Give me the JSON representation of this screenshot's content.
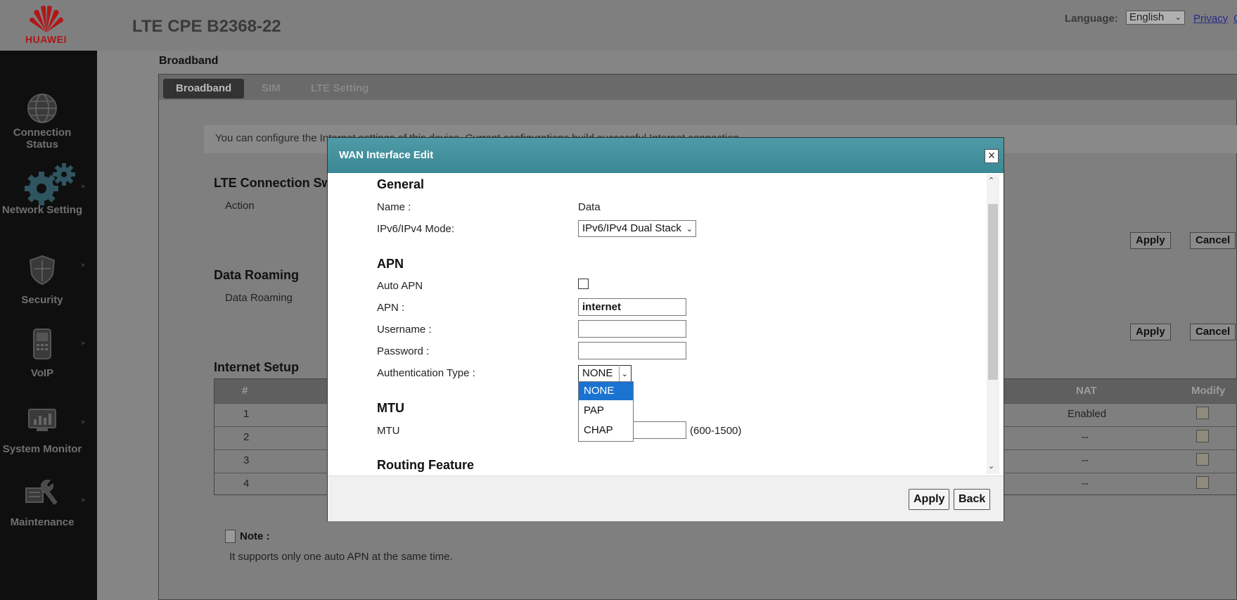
{
  "header": {
    "logo_text": "HUAWEI",
    "product_name": "LTE CPE B2368-22",
    "language_label": "Language:",
    "language_value": "English",
    "privacy_link": "Privacy",
    "privacy_link_cut": "C"
  },
  "sidebar": {
    "items": [
      {
        "label_line1": "Connection",
        "label_line2": "Status",
        "icon": "globe-icon"
      },
      {
        "label_line1": "Network Setting",
        "label_line2": "",
        "icon": "gears-icon"
      },
      {
        "label_line1": "Security",
        "label_line2": "",
        "icon": "shield-icon"
      },
      {
        "label_line1": "VoIP",
        "label_line2": "",
        "icon": "phone-icon"
      },
      {
        "label_line1": "System Monitor",
        "label_line2": "",
        "icon": "monitor-icon"
      },
      {
        "label_line1": "Maintenance",
        "label_line2": "",
        "icon": "wrench-icon"
      }
    ]
  },
  "page": {
    "title": "Broadband",
    "tabs": [
      "Broadband",
      "SIM",
      "LTE Setting"
    ],
    "info_text": "You can configure the Internet settings of this device. Current configurations build successful Internet connection.",
    "lte_section": {
      "title": "LTE Connection Sw",
      "action_label": "Action",
      "apply": "Apply",
      "cancel": "Cancel"
    },
    "roaming_section": {
      "title": "Data Roaming",
      "label": "Data Roaming",
      "apply": "Apply",
      "cancel": "Cancel"
    },
    "internet_setup": {
      "title": "Internet Setup",
      "columns": {
        "index": "#",
        "nat": "NAT",
        "modify": "Modify"
      },
      "rows": [
        {
          "index": "1",
          "nat": "Enabled"
        },
        {
          "index": "2",
          "nat": "--"
        },
        {
          "index": "3",
          "nat": "--"
        },
        {
          "index": "4",
          "nat": "--"
        }
      ]
    },
    "note": {
      "label": "Note :",
      "text": "It supports only one auto APN at the same time."
    }
  },
  "modal": {
    "title": "WAN Interface Edit",
    "close_symbol": "×",
    "general": {
      "heading": "General",
      "name_label": "Name :",
      "name_value": "Data",
      "mode_label": "IPv6/IPv4 Mode:",
      "mode_value": "IPv6/IPv4 Dual Stack"
    },
    "apn": {
      "heading": "APN",
      "auto_apn_label": "Auto APN",
      "auto_apn_checked": false,
      "apn_label": "APN :",
      "apn_value": "internet",
      "username_label": "Username :",
      "username_value": "",
      "password_label": "Password :",
      "password_value": "",
      "auth_label": "Authentication Type :",
      "auth_value": "NONE",
      "auth_options": [
        "NONE",
        "PAP",
        "CHAP"
      ]
    },
    "mtu": {
      "heading": "MTU",
      "label": "MTU",
      "value": "",
      "range": "(600-1500)"
    },
    "routing": {
      "heading": "Routing Feature"
    },
    "buttons": {
      "apply": "Apply",
      "back": "Back"
    }
  }
}
